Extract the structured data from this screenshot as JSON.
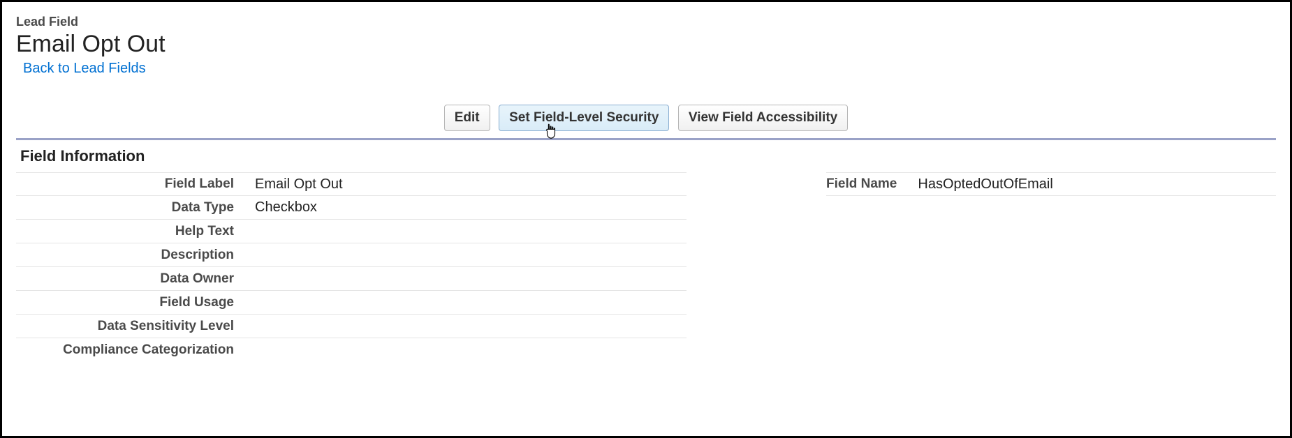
{
  "header": {
    "object_type": "Lead Field",
    "title": "Email Opt Out",
    "back_link": "Back to Lead Fields"
  },
  "buttons": {
    "edit": "Edit",
    "set_security": "Set Field-Level Security",
    "view_accessibility": "View Field Accessibility"
  },
  "section": {
    "title": "Field Information"
  },
  "fields": {
    "left": [
      {
        "label": "Field Label",
        "value": "Email Opt Out"
      },
      {
        "label": "Data Type",
        "value": "Checkbox"
      },
      {
        "label": "Help Text",
        "value": ""
      },
      {
        "label": "Description",
        "value": ""
      },
      {
        "label": "Data Owner",
        "value": ""
      },
      {
        "label": "Field Usage",
        "value": ""
      },
      {
        "label": "Data Sensitivity Level",
        "value": ""
      },
      {
        "label": "Compliance Categorization",
        "value": ""
      }
    ],
    "right": {
      "field_name_label": "Field Name",
      "field_name_value": "HasOptedOutOfEmail"
    }
  }
}
